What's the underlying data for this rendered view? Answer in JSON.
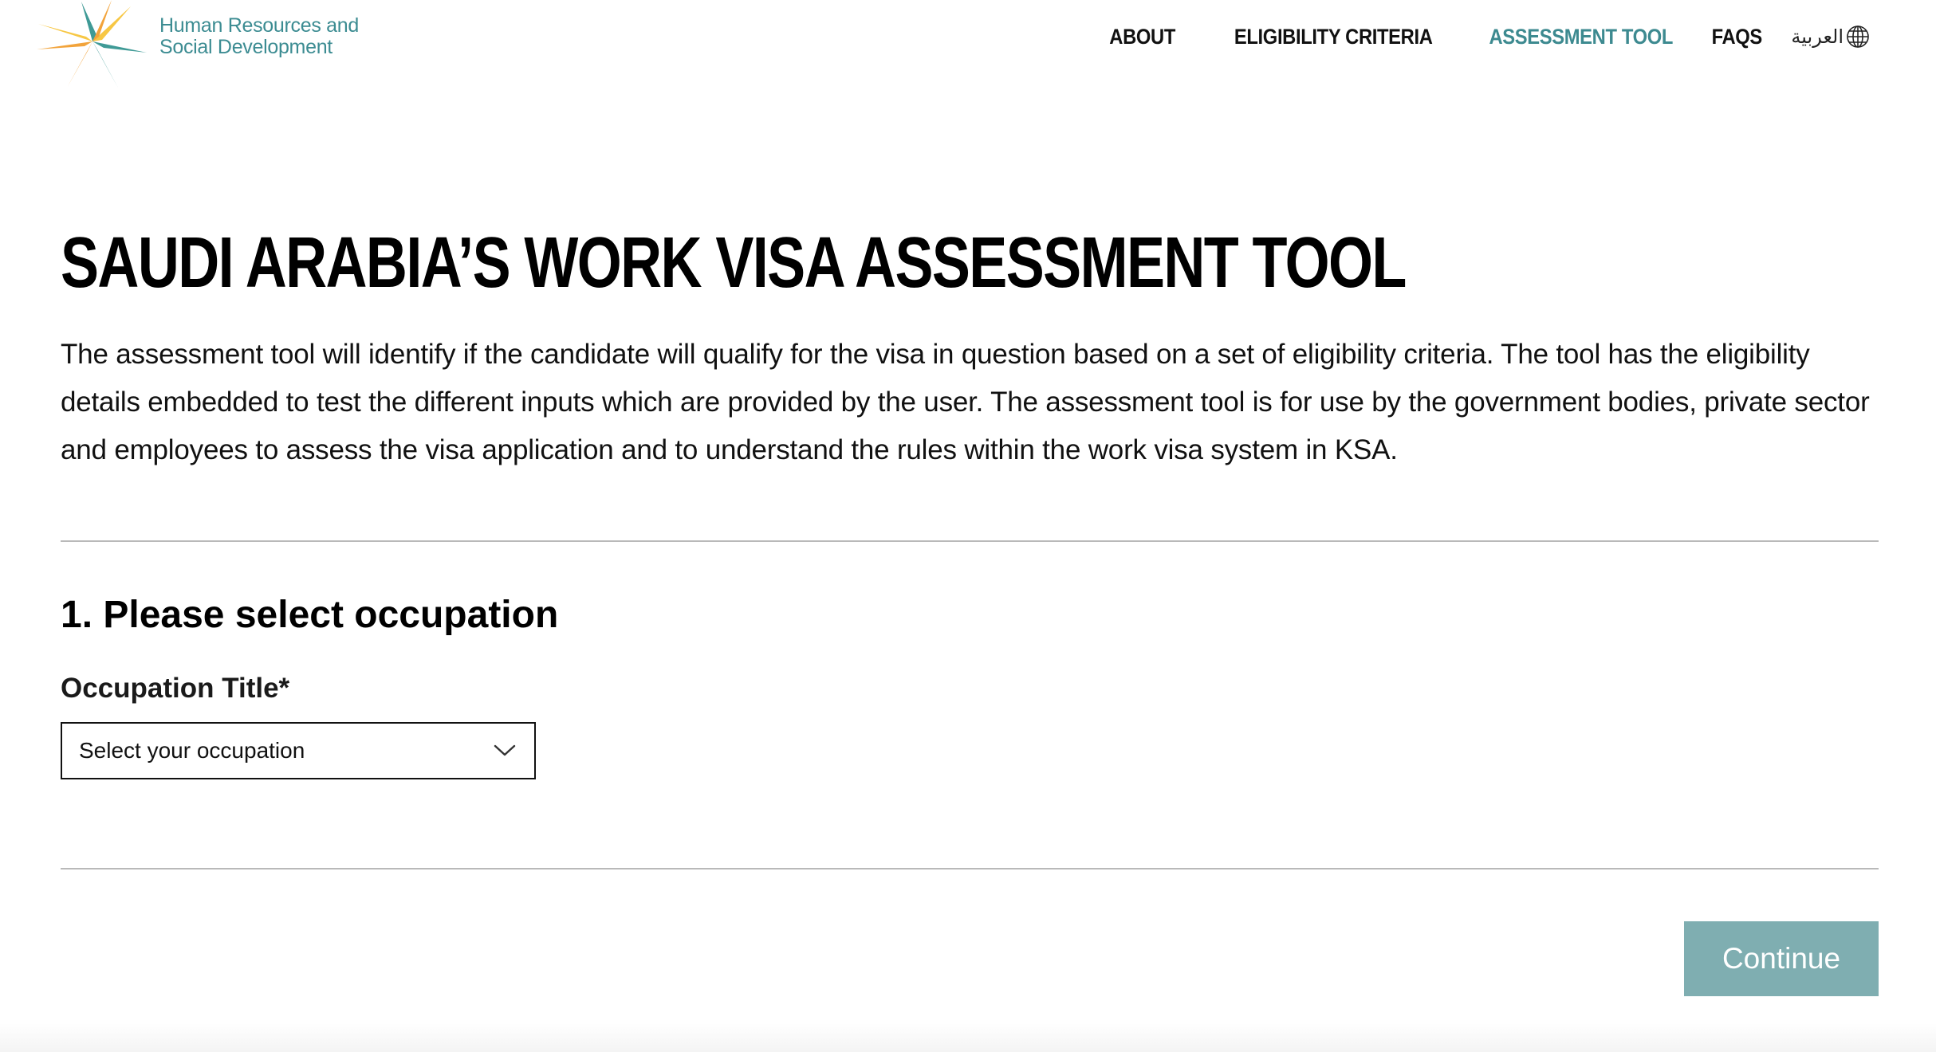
{
  "header": {
    "logo": {
      "line1": "Human Resources and",
      "line2": "Social Development",
      "icon": "ministry-star-logo"
    },
    "nav": [
      {
        "label": "ABOUT",
        "active": false
      },
      {
        "label": "ELIGIBILITY CRITERIA",
        "active": false
      },
      {
        "label": "ASSESSMENT TOOL",
        "active": true
      },
      {
        "label": "FAQS",
        "active": false
      }
    ],
    "language": {
      "label": "العربية",
      "icon": "globe-icon"
    }
  },
  "main": {
    "title": "SAUDI ARABIA’S WORK VISA ASSESSMENT TOOL",
    "intro": "The assessment tool will identify if the candidate will qualify for the visa in question based on a set of eligibility criteria. The tool has the eligibility details embedded to test the different inputs which are provided by the user. The assessment tool is for use by the government bodies, private sector and employees to assess the visa application and to understand the rules within the work visa system in KSA.",
    "step": {
      "heading": "1. Please select occupation",
      "field_label": "Occupation Title*",
      "select": {
        "value": "Select your occupation",
        "icon": "chevron-down-icon"
      }
    },
    "continue_label": "Continue"
  },
  "colors": {
    "accent": "#3d8a90",
    "button": "#7faeb1",
    "logo_orange": "#f2a33a",
    "logo_yellow": "#f7c744",
    "logo_teal": "#3f9a96",
    "divider": "#b9b9b9"
  }
}
